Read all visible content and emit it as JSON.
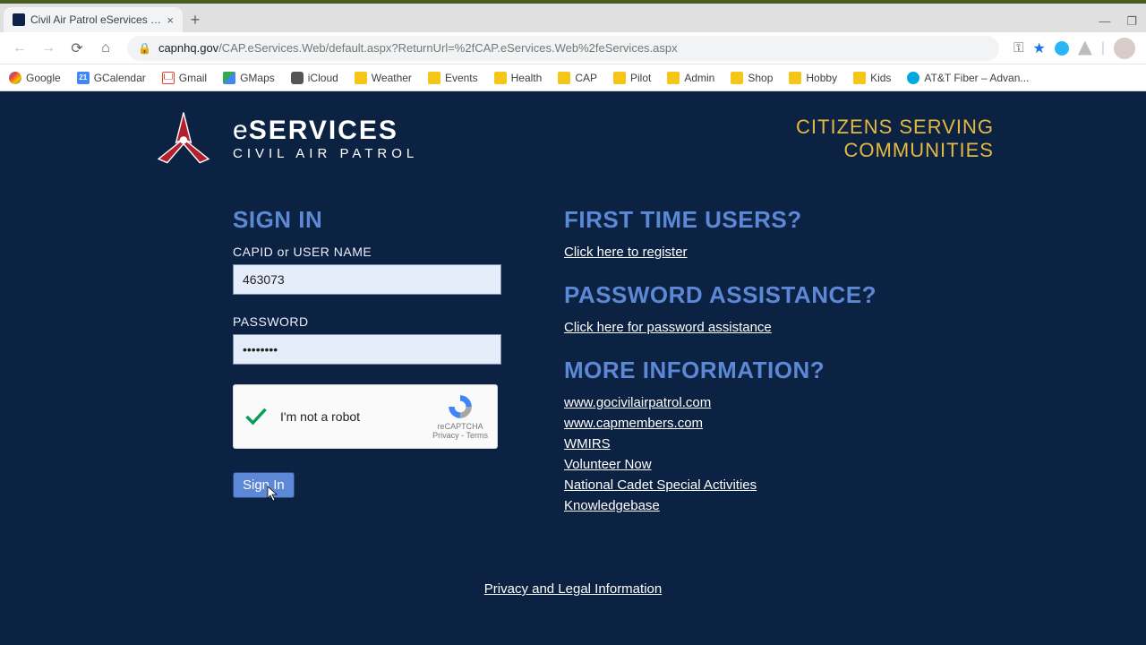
{
  "browser": {
    "tab_title": "Civil Air Patrol eServices Sign In",
    "url_host": "capnhq.gov",
    "url_path": "/CAP.eServices.Web/default.aspx?ReturnUrl=%2fCAP.eServices.Web%2feServices.aspx",
    "bookmarks": [
      "Google",
      "GCalendar",
      "Gmail",
      "GMaps",
      "iCloud",
      "Weather",
      "Events",
      "Health",
      "CAP",
      "Pilot",
      "Admin",
      "Shop",
      "Hobby",
      "Kids",
      "AT&T Fiber – Advan..."
    ]
  },
  "header": {
    "brand_e": "e",
    "brand_main": "SERVICES",
    "brand_sub": "CIVIL AIR PATROL",
    "motto_line1": "CITIZENS SERVING",
    "motto_line2": "COMMUNITIES"
  },
  "signin": {
    "heading": "SIGN IN",
    "capid_label": "CAPID or USER NAME",
    "capid_value": "463073",
    "password_label": "PASSWORD",
    "password_value": "••••••••",
    "captcha_label": "I'm not a robot",
    "captcha_badge": "reCAPTCHA",
    "captcha_terms": "Privacy - Terms",
    "button": "Sign In"
  },
  "first_time": {
    "heading": "FIRST TIME USERS?",
    "link": "Click here to register"
  },
  "password_assist": {
    "heading": "PASSWORD ASSISTANCE?",
    "link": "Click here for password assistance"
  },
  "more_info": {
    "heading": "MORE INFORMATION?",
    "links": [
      "www.gocivilairpatrol.com",
      "www.capmembers.com",
      "WMIRS",
      "Volunteer Now",
      "National Cadet Special Activities",
      "Knowledgebase"
    ]
  },
  "footer": {
    "link": "Privacy and Legal Information"
  }
}
